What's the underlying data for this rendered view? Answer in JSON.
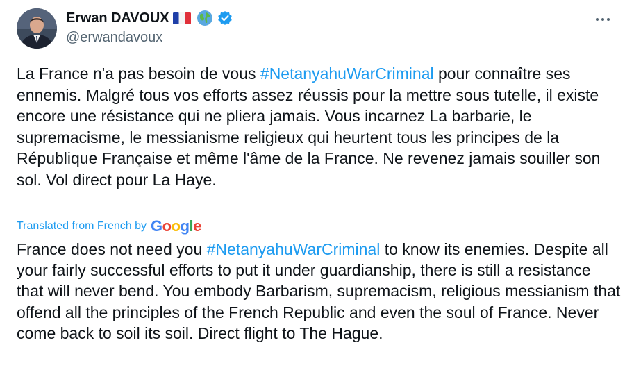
{
  "author": {
    "display_name": "Erwan DAVOUX",
    "handle": "@erwandavoux"
  },
  "icons": {
    "flag": "france-flag-icon",
    "globe": "globe-icon",
    "verified": "verified-badge-icon",
    "more": "more-options-icon"
  },
  "colors": {
    "link": "#1d9bf0",
    "text": "#0f1419",
    "secondary": "#536471"
  },
  "original": {
    "before_hashtag": "La France n'a pas besoin de vous ",
    "hashtag": "#NetanyahuWarCriminal",
    "after_hashtag": " pour connaître ses ennemis. Malgré tous vos efforts assez réussis pour la mettre sous tutelle, il existe encore une résistance qui ne pliera jamais. Vous incarnez  La barbarie, le supremacisme, le messianisme religieux qui heurtent tous les principes de la République Française et même l'âme de la France. Ne revenez jamais souiller son sol. Vol direct pour La Haye."
  },
  "translation_label": "Translated from French by",
  "google_logo": [
    "G",
    "o",
    "o",
    "g",
    "l",
    "e"
  ],
  "translation": {
    "before_hashtag": "France does not need you ",
    "hashtag": "#NetanyahuWarCriminal",
    "after_hashtag": " to know its enemies. Despite all your fairly successful efforts to put it under guardianship, there is still a resistance that will never bend. You embody Barbarism, supremacism, religious messianism that offend all the principles of the French Republic and even the soul of France. Never come back to soil its soil. Direct flight to The Hague."
  }
}
